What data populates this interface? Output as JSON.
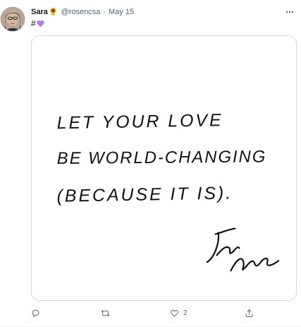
{
  "tweet": {
    "author_name": "Sara",
    "author_emoji": "🌻",
    "handle": "@rosencsa",
    "separator": "·",
    "date": "May 15",
    "text": "#",
    "text_emoji": "purple-heart",
    "media": {
      "lines": [
        "LET YOUR LOVE",
        "BE WORLD-CHANGING",
        "(BECAUSE IT IS)."
      ],
      "signature": "Jon Leo",
      "background": "#ffffff",
      "ink_color": "#111111"
    },
    "stats": {
      "replies": "",
      "retweets": "",
      "likes": "2"
    },
    "more_icon": "more-horizontal-icon"
  },
  "colors": {
    "secondary_text": "#536471",
    "border": "#cfd9de",
    "purple_heart": "#b07fe0"
  }
}
